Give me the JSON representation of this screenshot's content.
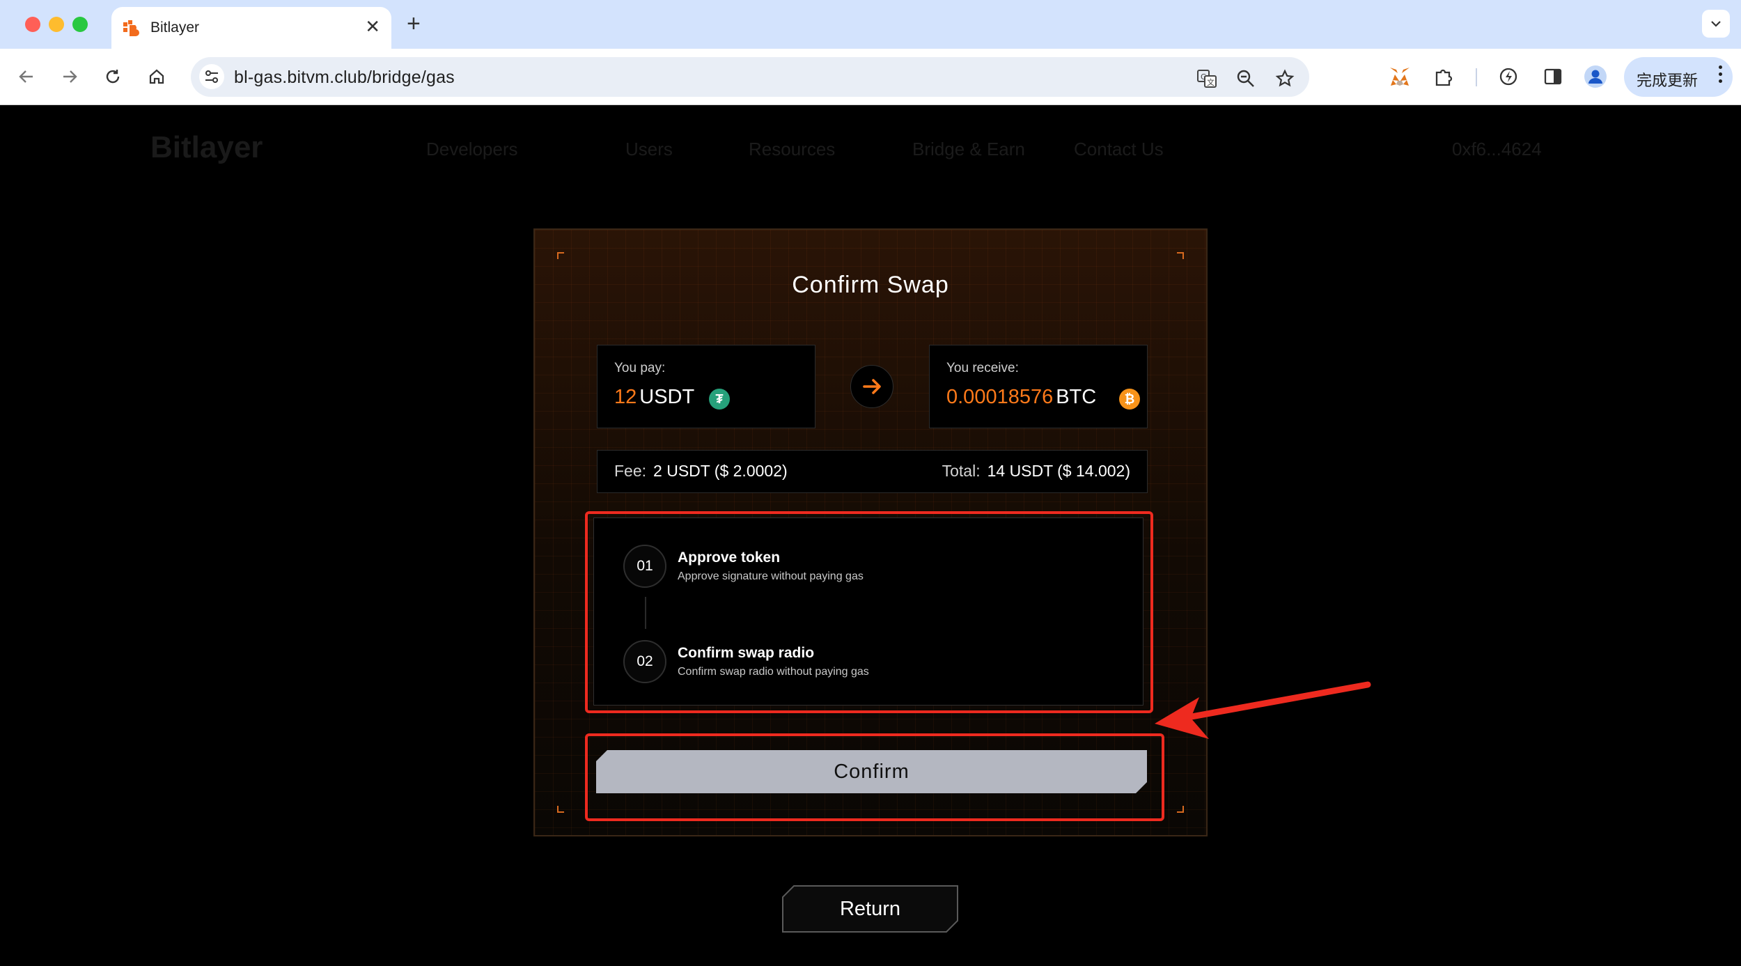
{
  "browser": {
    "tab_title": "Bitlayer",
    "url": "bl-gas.bitvm.club/bridge/gas",
    "update_button_label": "完成更新"
  },
  "site_nav": {
    "logo": "Bitlayer",
    "items": [
      "Developers",
      "Users",
      "Resources",
      "Bridge & Earn",
      "Contact Us"
    ],
    "wallet": "0xf6...4624"
  },
  "modal": {
    "title": "Confirm Swap",
    "pay": {
      "label": "You pay:",
      "amount": "12",
      "unit": "USDT"
    },
    "receive": {
      "label": "You receive:",
      "amount": "0.00018576",
      "unit": "BTC"
    },
    "fee": {
      "label": "Fee:",
      "value": "2 USDT ($ 2.0002)"
    },
    "total": {
      "label": "Total:",
      "value": "14 USDT ($ 14.002)"
    },
    "steps": [
      {
        "num": "01",
        "title": "Approve token",
        "desc": "Approve signature without paying gas"
      },
      {
        "num": "02",
        "title": "Confirm swap radio",
        "desc": "Confirm swap radio without paying gas"
      }
    ],
    "confirm_label": "Confirm"
  },
  "return_label": "Return",
  "colors": {
    "accent_orange": "#ff7a1a",
    "annotation_red": "#ee2a1f",
    "usdt_green": "#26a17b",
    "btc_orange": "#f7931a"
  }
}
